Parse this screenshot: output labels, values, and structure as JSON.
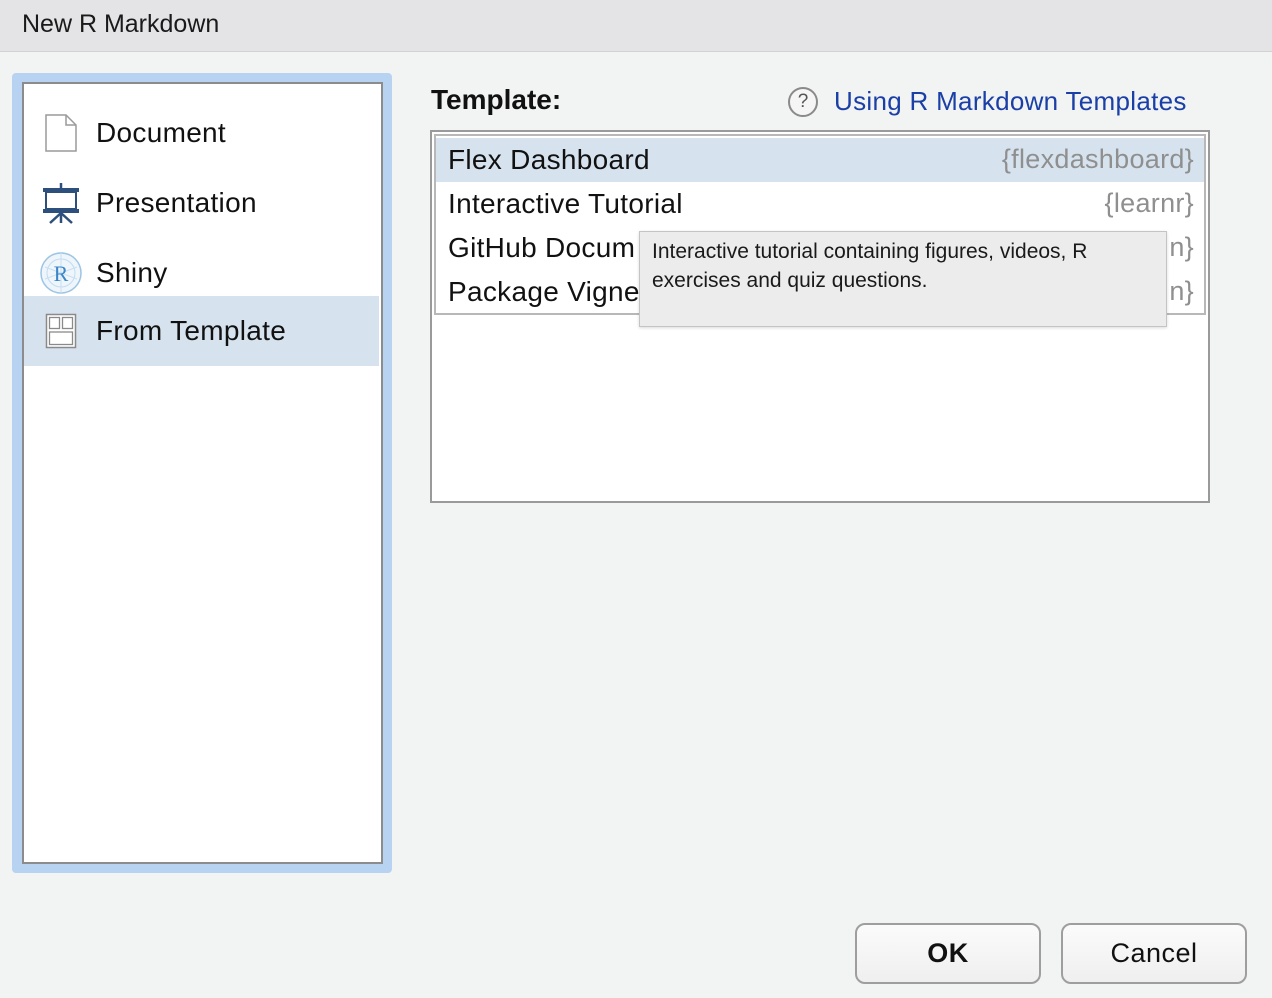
{
  "window": {
    "title": "New R Markdown"
  },
  "types": {
    "items": [
      {
        "label": "Document",
        "icon": "document-icon",
        "selected": false
      },
      {
        "label": "Presentation",
        "icon": "presentation-icon",
        "selected": false
      },
      {
        "label": "Shiny",
        "icon": "shiny-icon",
        "selected": false
      },
      {
        "label": "From Template",
        "icon": "template-icon",
        "selected": true
      }
    ]
  },
  "template": {
    "heading": "Template:",
    "help_link": "Using R Markdown Templates",
    "help_icon": "?",
    "rows": [
      {
        "name": "Flex Dashboard",
        "package": "{flexdashboard}",
        "selected": true
      },
      {
        "name": "Interactive Tutorial",
        "package": "{learnr}",
        "selected": false
      },
      {
        "name": "GitHub Docum",
        "package": "n}",
        "selected": false
      },
      {
        "name": "Package Vigne",
        "package": "n}",
        "selected": false
      }
    ],
    "tooltip": "Interactive tutorial containing figures, videos, R exercises and quiz questions."
  },
  "buttons": {
    "ok": "OK",
    "cancel": "Cancel"
  },
  "colors": {
    "selection": "#d6e3ef",
    "link": "#1a3fa6",
    "focus_ring": "#b7d3f1"
  }
}
